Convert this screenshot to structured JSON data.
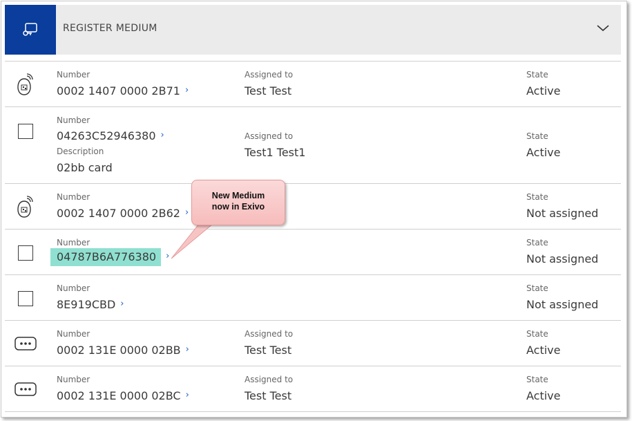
{
  "header": {
    "title": "REGISTER MEDIUM",
    "icon": "register-key-icon",
    "accent": "#0a3d9c",
    "expand_icon": "chevron-down-icon"
  },
  "labels": {
    "number": "Number",
    "assigned_to": "Assigned to",
    "state": "State",
    "description": "Description"
  },
  "rows": [
    {
      "icon": "rfid-keyfob-icon",
      "number": "0002 1407 0000 2B71",
      "assigned_to": "Test Test",
      "state": "Active"
    },
    {
      "icon": "card-icon",
      "number": "04263C52946380",
      "description": "02bb card",
      "assigned_to": "Test1 Test1",
      "state": "Active"
    },
    {
      "icon": "rfid-keyfob-icon",
      "number": "0002 1407 0000 2B62",
      "state": "Not assigned"
    },
    {
      "icon": "card-icon",
      "number": "04787B6A776380",
      "state": "Not assigned",
      "highlight": "#8fe0d0"
    },
    {
      "icon": "card-icon",
      "number": "8E919CBD",
      "state": "Not assigned"
    },
    {
      "icon": "pin-code-icon",
      "number": "0002 131E 0000 02BB",
      "assigned_to": "Test Test",
      "state": "Active"
    },
    {
      "icon": "pin-code-icon",
      "number": "0002 131E 0000 02BC",
      "assigned_to": "Test Test",
      "state": "Active"
    }
  ],
  "callout": {
    "line1": "New Medium",
    "line2": "now in Exivo"
  }
}
